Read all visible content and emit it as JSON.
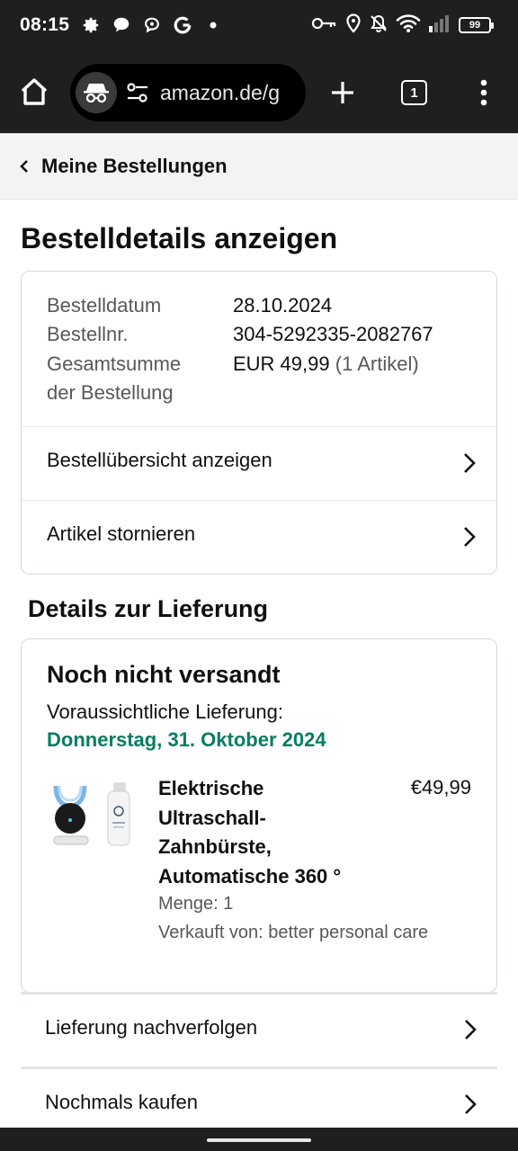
{
  "status_bar": {
    "time": "08:15",
    "left_icons": [
      "gear-icon",
      "chat-bubble-icon",
      "assistant-bubble-icon",
      "google-icon",
      "dot-icon"
    ],
    "right_icons": [
      "key-icon",
      "location-icon",
      "bell-off-icon",
      "wifi-icon",
      "signal-icon"
    ],
    "battery": "99"
  },
  "browser": {
    "url": "amazon.de/g",
    "tab_count": "1"
  },
  "breadcrumb": {
    "label": "Meine Bestellungen"
  },
  "page": {
    "title": "Bestelldetails anzeigen"
  },
  "summary": {
    "date_label": "Bestelldatum",
    "date_value": "28.10.2024",
    "order_no_label": "Bestellnr.",
    "order_no_value": "304-5292335-2082767",
    "total_label_line1": "Gesamtsumme",
    "total_label_line2": "der Bestellung",
    "total_value": "EUR 49,99",
    "total_items": "(1 Artikel)",
    "links": [
      {
        "label": "Bestellübersicht anzeigen"
      },
      {
        "label": "Artikel stornieren"
      }
    ]
  },
  "delivery": {
    "section_title": "Details zur Lieferung",
    "status": "Noch nicht versandt",
    "eta_label": "Voraussichtliche Lieferung:",
    "eta_date": "Donnerstag, 31. Oktober 2024",
    "product": {
      "name_lines": [
        "Elektrische",
        "Ultraschall-",
        "Zahnbürste,",
        "Automatische 360 °"
      ],
      "price": "€49,99",
      "quantity": "Menge: 1",
      "seller": "Verkauft von: better personal care"
    }
  },
  "actions": [
    {
      "label": "Lieferung nachverfolgen"
    },
    {
      "label": "Nochmals kaufen"
    }
  ],
  "colors": {
    "delivery_green": "#067d62",
    "text": "#0f1111",
    "muted": "#565959",
    "chrome_bar": "#1f1f1f"
  }
}
